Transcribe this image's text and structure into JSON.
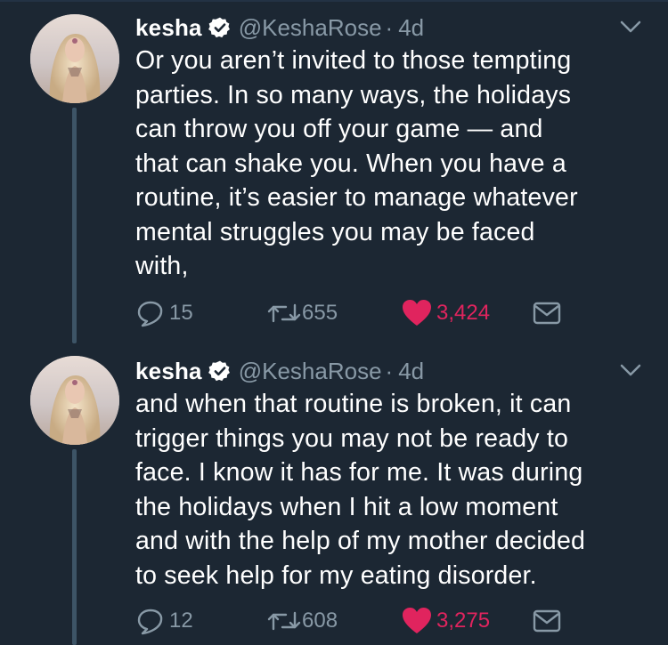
{
  "colors": {
    "background": "#1c2733",
    "text": "#ffffff",
    "secondary": "#8899a6",
    "like": "#e0245e",
    "verified_badge": "#ffffff",
    "thread_line": "#3d5466"
  },
  "tweets": [
    {
      "name": "kesha",
      "verified": true,
      "handle": "@KeshaRose",
      "separator": "·",
      "time": "4d",
      "lines": [
        "Or you aren’t invited to those tempting",
        "parties. In so many ways, the holidays",
        "can throw you off your game — and",
        "that can shake you. When you have a",
        "routine, it’s easier to manage whatever",
        "mental struggles you may be faced",
        "with,"
      ],
      "replies": "15",
      "retweets": "655",
      "likes": "3,424",
      "liked": true,
      "icons": [
        "reply-icon",
        "retweet-icon",
        "heart-icon",
        "mail-icon",
        "chevron-down-icon",
        "verified-icon"
      ]
    },
    {
      "name": "kesha",
      "verified": true,
      "handle": "@KeshaRose",
      "separator": "·",
      "time": "4d",
      "lines": [
        "and when that routine is broken, it can",
        "trigger things you may not be ready to",
        "face. I know it has for me. It was during",
        "the holidays when I hit a low moment",
        "and with the help of my mother decided",
        "to seek help for my eating disorder."
      ],
      "replies": "12",
      "retweets": "608",
      "likes": "3,275",
      "liked": true,
      "icons": [
        "reply-icon",
        "retweet-icon",
        "heart-icon",
        "mail-icon",
        "chevron-down-icon",
        "verified-icon"
      ]
    }
  ]
}
